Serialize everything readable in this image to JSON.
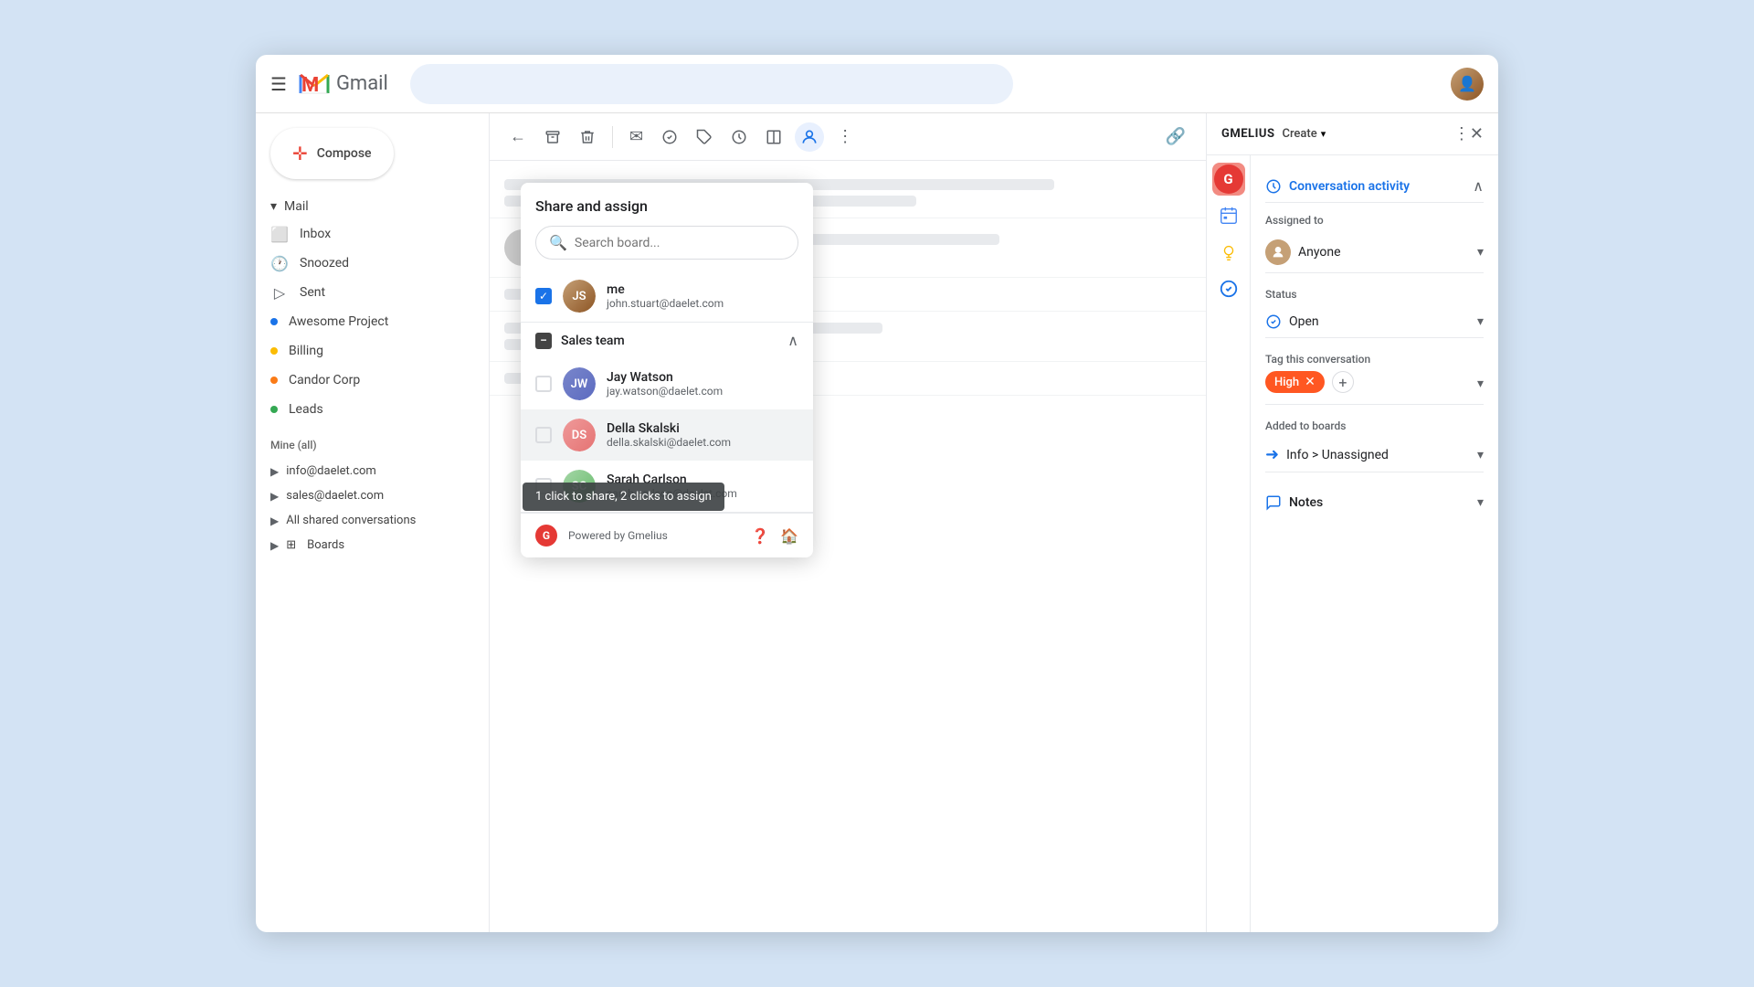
{
  "window": {
    "title": "Gmail"
  },
  "header": {
    "menu_label": "☰",
    "gmail_text": "Gmail",
    "search_placeholder": ""
  },
  "sidebar": {
    "compose_label": "Compose",
    "mail_section": "Mail",
    "nav_items": [
      {
        "id": "inbox",
        "icon": "⬜",
        "label": "Inbox"
      },
      {
        "id": "snoozed",
        "icon": "🕐",
        "label": "Snoozed"
      },
      {
        "id": "sent",
        "icon": "▷",
        "label": "Sent"
      },
      {
        "id": "awesome-project",
        "icon": "●",
        "label": "Awesome Project",
        "dot_color": "#1a73e8"
      },
      {
        "id": "billing",
        "icon": "●",
        "label": "Billing",
        "dot_color": "#fbbc04"
      },
      {
        "id": "candor-corp",
        "icon": "●",
        "label": "Candor Corp",
        "dot_color": "#fa7b17"
      },
      {
        "id": "leads",
        "icon": "●",
        "label": "Leads",
        "dot_color": "#34a853"
      }
    ],
    "mine_all_label": "Mine (all)",
    "sub_items": [
      {
        "id": "info-daelet",
        "label": "info@daelet.com"
      },
      {
        "id": "sales-daelet",
        "label": "sales@daelet.com"
      },
      {
        "id": "all-shared",
        "label": "All shared conversations"
      },
      {
        "id": "boards",
        "label": "Boards"
      }
    ]
  },
  "toolbar": {
    "back_label": "←",
    "archive_label": "⬒",
    "delete_label": "🗑",
    "mark_label": "✉",
    "task_label": "✓",
    "label_label": "🏷",
    "clock_label": "⏱",
    "split_label": "⊟",
    "share_label": "👤",
    "more_label": "⋮"
  },
  "gmelius": {
    "title": "GMELIUS",
    "create_label": "Create",
    "more_label": "⋮",
    "close_label": "✕",
    "panel_title": "Conversation activity",
    "assigned_to_label": "Assigned to",
    "assigned_value": "Anyone",
    "status_label": "Status",
    "status_value": "Open",
    "tag_label": "Tag this conversation",
    "tag_value": "High",
    "tag_add": "+",
    "boards_label": "Added to boards",
    "boards_value": "Info > Unassigned",
    "notes_label": "Notes"
  },
  "popup": {
    "title": "Share and assign",
    "search_placeholder": "Search board...",
    "users": [
      {
        "id": "me",
        "name": "me",
        "email": "john.stuart@daelet.com",
        "checked": true
      },
      {
        "id": "jay",
        "name": "Jay Watson",
        "email": "jay.watson@daelet.com",
        "checked": false
      },
      {
        "id": "della",
        "name": "Della Skalski",
        "email": "della.skalski@daelet.com",
        "checked": false
      },
      {
        "id": "sarah",
        "name": "Sarah Carlson",
        "email": "sarah.carlson@daelet.com",
        "checked": false
      }
    ],
    "team_label": "Sales team",
    "tooltip_text": "1 click to share, 2 clicks to assign",
    "footer_powered": "Powered by Gmelius"
  }
}
